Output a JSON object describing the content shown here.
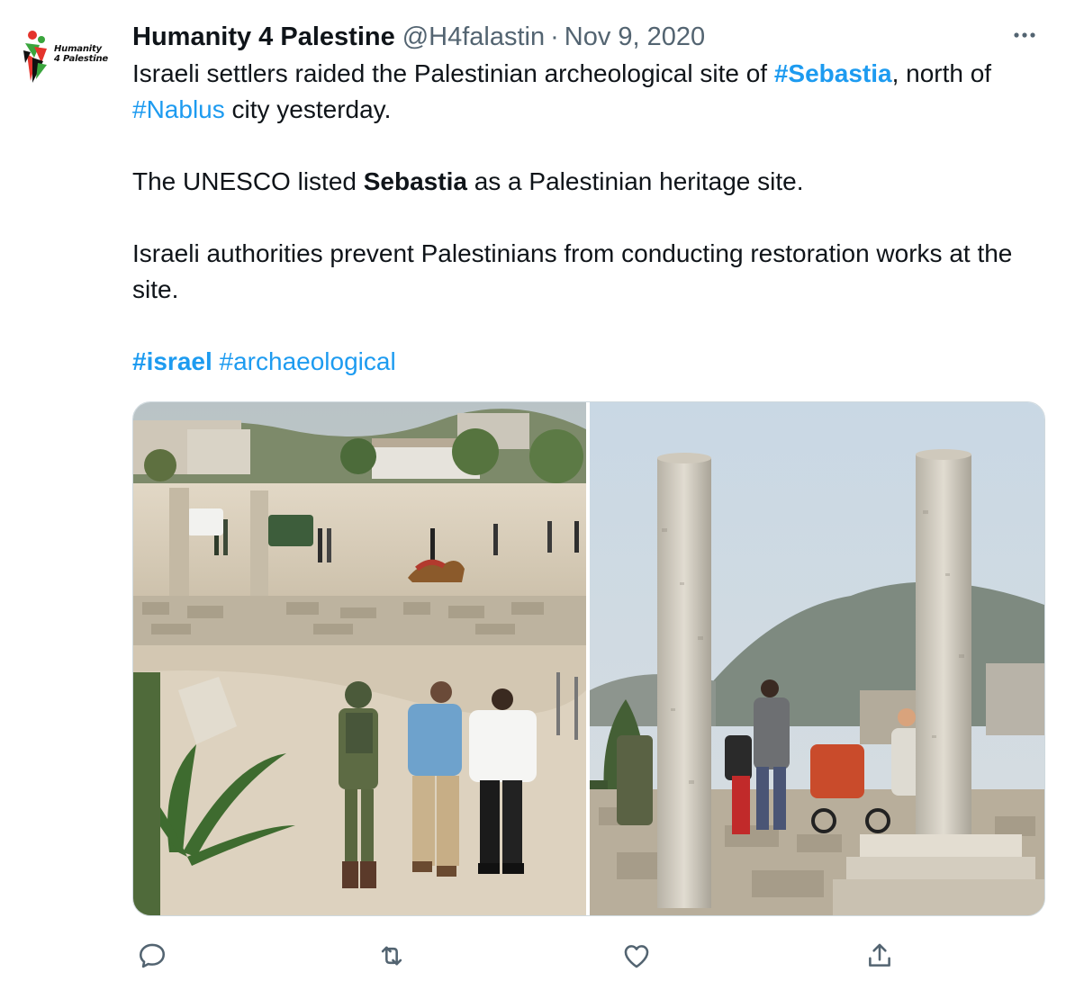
{
  "tweet": {
    "author": {
      "display_name": "Humanity 4 Palestine",
      "handle": "@H4falastin",
      "separator": "·",
      "date": "Nov 9, 2020",
      "avatar_text_line1": "Humanity",
      "avatar_text_line2": "4 Palestine"
    },
    "body": {
      "p1_a": "Israeli settlers raided the Palestinian archeological site of ",
      "p1_tag1": "#Sebastia",
      "p1_b": ", north of ",
      "p1_tag2": "#Nablus",
      "p1_c": " city yesterday.",
      "p2_a": "The UNESCO listed ",
      "p2_bold": "Sebastia",
      "p2_b": " as a Palestinian heritage site.",
      "p3": "Israeli authorities prevent Palestinians from conducting restoration works at the site.",
      "tag_israel": "#israel",
      "tag_archaeological": "#archaeological"
    },
    "actions": {
      "reply_icon": "reply-icon",
      "retweet_icon": "retweet-icon",
      "like_icon": "heart-icon",
      "share_icon": "share-icon",
      "more_icon": "more-icon"
    },
    "colors": {
      "link": "#1d9bf0",
      "secondary_text": "#536471",
      "primary_text": "#0f1419",
      "border": "#cfd9de"
    }
  }
}
